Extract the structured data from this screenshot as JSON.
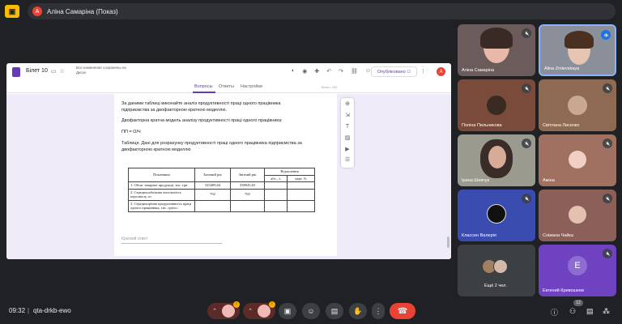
{
  "meet": {
    "app_badge": "▣",
    "presenter_initial": "A",
    "presenter_text": "Аліна Самаріна (Показ)",
    "time": "09:32",
    "separator": "|",
    "meeting_code": "qta-drkb-ewo",
    "participants_count": "12",
    "mic_badge": "!",
    "cam_badge": "!"
  },
  "doc": {
    "title": "Білет 10",
    "saved": "Все изменения сохранены на Диске",
    "publish_label": "Опубліковано",
    "avatar_initial": "A",
    "tabs": [
      "Вопросы",
      "Ответы",
      "Настройки"
    ],
    "points": "Всего: 100",
    "question_lines": [
      "За даними таблиці виконайте аналіз продуктивності праці одного працівника",
      "підприємства за двофакторною кратною моделлю."
    ],
    "model_text": "Двофакторна кратна модель аналізу продуктивності праці одного працівника:",
    "formula": "ПП = О/Ч",
    "caption_lines": [
      "Таблиця. Дані для розрахунку продуктивності праці одного працівника підприємства за",
      "двофакторною кратною моделлю"
    ],
    "table": {
      "headers": {
        "indicator": "Показники",
        "base": "Базовий рік",
        "report": "Звітний рік",
        "deviation": "Відхилення",
        "abs": "абс., ±",
        "rel": "відн. %"
      },
      "rows": [
        {
          "name": "1. Обсяг товарної продукції, тис. грн",
          "base": "325409,04",
          "report": "358945,65",
          "abs": "",
          "rel": ""
        },
        {
          "name": "2. Середньооблікова чисельність персоналу, ос.",
          "base": "792",
          "report": "765",
          "abs": "",
          "rel": ""
        },
        {
          "name": "3. Середньорічна продуктивність праці одного працівника, тис. грн/ос.",
          "base": "",
          "report": "",
          "abs": "",
          "rel": ""
        }
      ]
    },
    "answer_placeholder": "Краткий ответ"
  },
  "participants": [
    {
      "name": "Аліна Самаріна",
      "bg": "#6b5b5b",
      "mic_off": true
    },
    {
      "name": "Alina Zmievskaya",
      "bg": "#8a8f9a",
      "mic_off": false,
      "speaking": true
    },
    {
      "name": "Поліна Пильникова",
      "bg": "#7a4a3a",
      "mic_off": true
    },
    {
      "name": "Світлана Лисенко",
      "bg": "#8e6a52",
      "mic_off": true
    },
    {
      "name": "Ірина Шевчук",
      "bg": "#9a9a8e",
      "mic_off": true
    },
    {
      "name": "Аміна",
      "bg": "#a07060",
      "mic_off": true
    },
    {
      "name": "Классен Валерія",
      "bg": "#3b4cb0",
      "mic_off": true
    },
    {
      "name": "Сніжана Чайка",
      "bg": "#8a6058",
      "mic_off": true
    },
    {
      "name": "Ещё 2 чел.",
      "bg": "#3c4043",
      "mic_off": false
    },
    {
      "name": "Евгений Кривошеев",
      "bg": "#6f42c1",
      "mic_off": true,
      "initial": "E"
    }
  ]
}
